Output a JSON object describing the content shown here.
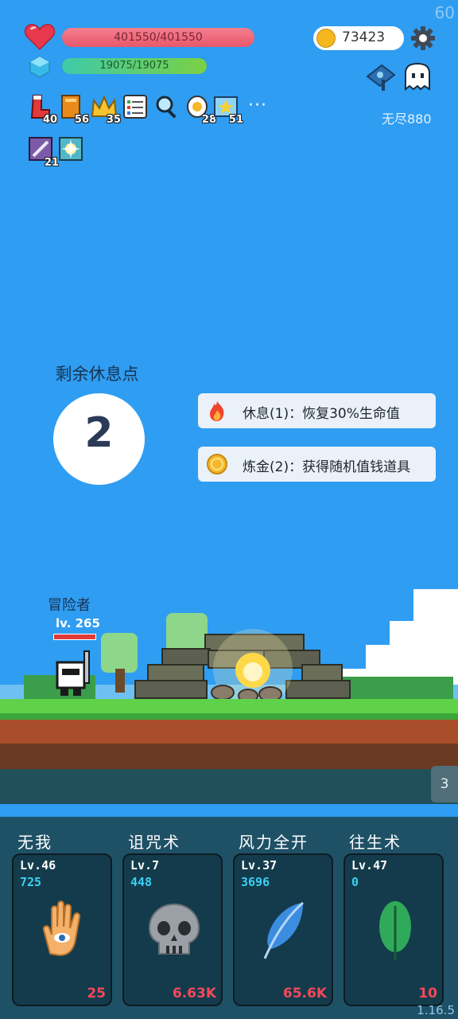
{
  "fps": "60",
  "version": "1.16.5",
  "hud": {
    "hp_text": "401550/401550",
    "hp_fraction": 1.0,
    "mp_text": "19075/19075",
    "mp_fraction": 1.0,
    "coins": "73423",
    "endless_label": "无尽880"
  },
  "items": [
    {
      "icon": "boot-icon",
      "count": "40"
    },
    {
      "icon": "book-icon",
      "count": "56"
    },
    {
      "icon": "crown-icon",
      "count": "35"
    },
    {
      "icon": "list-icon",
      "count": ""
    },
    {
      "icon": "magnifier-icon",
      "count": ""
    },
    {
      "icon": "egg-icon",
      "count": "28"
    },
    {
      "icon": "star-card-icon",
      "count": "51"
    },
    {
      "icon": "sword-scroll-icon",
      "count": "21"
    },
    {
      "icon": "sparkle-icon",
      "count": ""
    }
  ],
  "more_label": "···",
  "rest": {
    "label": "剩余休息点",
    "count": "2",
    "options": [
      {
        "icon": "fire-icon",
        "label": "休息(1)：恢复30%生命值"
      },
      {
        "icon": "coin-icon",
        "label": "炼金(2)：获得随机值钱道具"
      }
    ]
  },
  "hero": {
    "name": "冒险者",
    "level": "lv. 265",
    "hp_fraction": 1.0
  },
  "tab_badge": "3",
  "skills": [
    {
      "name": "无我",
      "level": "Lv.46",
      "value": "725",
      "cost": "25",
      "icon": "hand-eye-icon"
    },
    {
      "name": "诅咒术",
      "level": "Lv.7",
      "value": "448",
      "cost": "6.63K",
      "icon": "skull-icon"
    },
    {
      "name": "风力全开",
      "level": "Lv.37",
      "value": "3696",
      "cost": "65.6K",
      "icon": "feather-icon"
    },
    {
      "name": "往生术",
      "level": "Lv.47",
      "value": "0",
      "cost": "10",
      "icon": "leaf-icon"
    }
  ],
  "colors": {
    "sky": "#2f9df2",
    "hp": "#e8576a",
    "accent_value": "#3bd0f5",
    "cost": "#f4495a"
  }
}
